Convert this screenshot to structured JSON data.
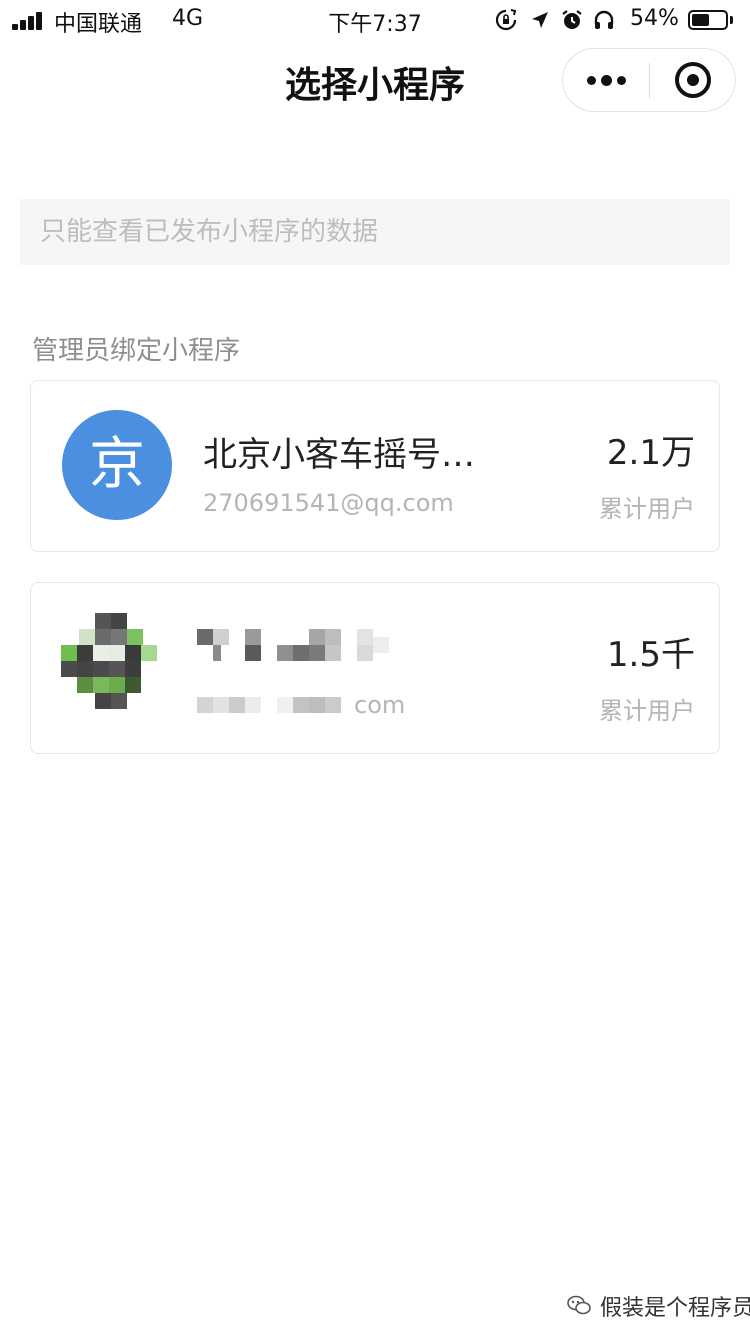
{
  "status_bar": {
    "carrier": "中国联通",
    "network": "4G",
    "time": "下午7:37",
    "battery_percent": "54%",
    "battery_level": 0.54,
    "icons": [
      "orientation-lock-icon",
      "location-arrow-icon",
      "alarm-icon",
      "headphones-icon",
      "battery-icon"
    ]
  },
  "nav": {
    "title": "选择小程序",
    "more_icon": "more-dots-icon",
    "close_icon": "target-circle-icon"
  },
  "notice": {
    "text": "只能查看已发布小程序的数据"
  },
  "section": {
    "label": "管理员绑定小程序"
  },
  "apps": [
    {
      "avatar_char": "京",
      "name": "北京小客车摇号…",
      "email": "270691541@qq.com",
      "count": "2.1万",
      "count_label": "累计用户",
      "avatar_color": "#4a8fe0"
    },
    {
      "avatar_char": "",
      "name": "",
      "email_suffix": "com",
      "count": "1.5千",
      "count_label": "累计用户",
      "redacted": true
    }
  ],
  "watermark": {
    "text": "假装是个程序员"
  }
}
